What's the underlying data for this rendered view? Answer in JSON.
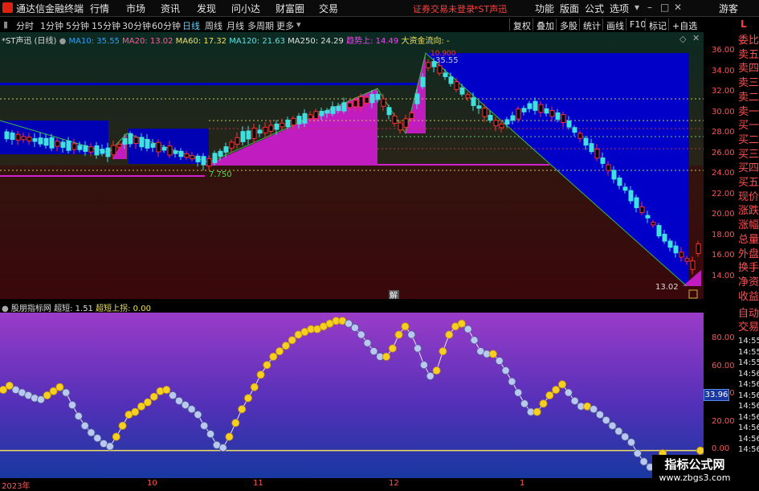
{
  "menubar": {
    "app_title": "通达信金融终端",
    "items": [
      "行情",
      "市场",
      "资讯",
      "发现",
      "问小达",
      "财富圈",
      "交易"
    ],
    "status": "证券交易未登录",
    "stock": "*ST声迅",
    "right_items": [
      "功能",
      "版面",
      "公式",
      "选项"
    ],
    "guest": "游客",
    "win_controls": [
      "▾",
      "–",
      "□",
      "✕"
    ]
  },
  "toolbar": {
    "periods": [
      "分时",
      "1分钟",
      "5分钟",
      "15分钟",
      "30分钟",
      "60分钟",
      "日线",
      "周线",
      "月线",
      "多周期",
      "更多"
    ],
    "active_period": "日线",
    "right_buttons": [
      "复权",
      "叠加",
      "多股",
      "统计",
      "画线",
      "F10",
      "标记",
      "+自选"
    ],
    "l_button": "L"
  },
  "main_chart": {
    "legend": {
      "stock": "*ST声迅 (日线)",
      "ma10": "MA10: 35.55",
      "ma20": "MA20: 13.02",
      "ma60": "MA60: 17.32",
      "ma120": "MA120: 21.63",
      "ma250": "MA250: 24.29",
      "trend": "趋势上: 14.49",
      "fund": "大资金流向: -"
    },
    "annotations": {
      "low": "7.750",
      "peak_sub": "35.55",
      "peak": "10.900",
      "last": "13.02"
    },
    "y_ticks": [
      "36.00",
      "34.00",
      "32.00",
      "30.00",
      "28.00",
      "26.00",
      "24.00",
      "22.00",
      "20.00",
      "18.00",
      "16.00",
      "14.00"
    ],
    "unlock_label": "解"
  },
  "indicator": {
    "name": "股朋指标网",
    "value_label": "超短: 1.51",
    "signal_label": "超短上拐: 0.00",
    "y_ticks": [
      "80.00",
      "60.00",
      "40.00",
      "20.00",
      "0.00"
    ],
    "current_value": "33.96"
  },
  "xaxis": {
    "labels": [
      "2023年",
      "10",
      "11",
      "12",
      "1"
    ]
  },
  "right_panel": {
    "items": [
      "委比",
      "卖五",
      "卖四",
      "卖三",
      "卖二",
      "卖一",
      "买一",
      "买二",
      "买三",
      "买四",
      "买五",
      "现价",
      "涨跌",
      "涨幅",
      "总量",
      "外盘",
      "换手",
      "净资",
      "收益"
    ],
    "lower": [
      "自动",
      "交易",
      "14:55",
      "14:55",
      "14:55",
      "14:56",
      "14:56",
      "14:56",
      "14:56",
      "14:56",
      "14:56",
      "14:56",
      "14:56"
    ]
  },
  "watermark": {
    "line1": "指标公式网",
    "line2": "www.zbgs3.com"
  },
  "chart_data": {
    "type": "line",
    "series": [
      {
        "name": "超短",
        "values": [
          44,
          47,
          44,
          42,
          40,
          38,
          37,
          40,
          43,
          46,
          42,
          33,
          25,
          18,
          13,
          9,
          5,
          3,
          10,
          18,
          26,
          28,
          32,
          35,
          39,
          43,
          44,
          40,
          36,
          33,
          30,
          26,
          18,
          12,
          4,
          2,
          10,
          20,
          30,
          38,
          46,
          55,
          62,
          68,
          72,
          76,
          80,
          84,
          86,
          88,
          88,
          90,
          92,
          94,
          94,
          92,
          89,
          84,
          78,
          72,
          68,
          68,
          74,
          84,
          90,
          84,
          74,
          62,
          54,
          58,
          72,
          84,
          90,
          92,
          88,
          80,
          72,
          70,
          70,
          65,
          58,
          50,
          42,
          34,
          28,
          28,
          34,
          40,
          44,
          48,
          42,
          36,
          32,
          32,
          30,
          26,
          22,
          18,
          14,
          10,
          6,
          -2,
          -8,
          -12,
          -6,
          -2,
          -6,
          -10,
          -14,
          -18,
          -22,
          0
        ]
      }
    ],
    "ylim": [
      -20,
      100
    ]
  }
}
